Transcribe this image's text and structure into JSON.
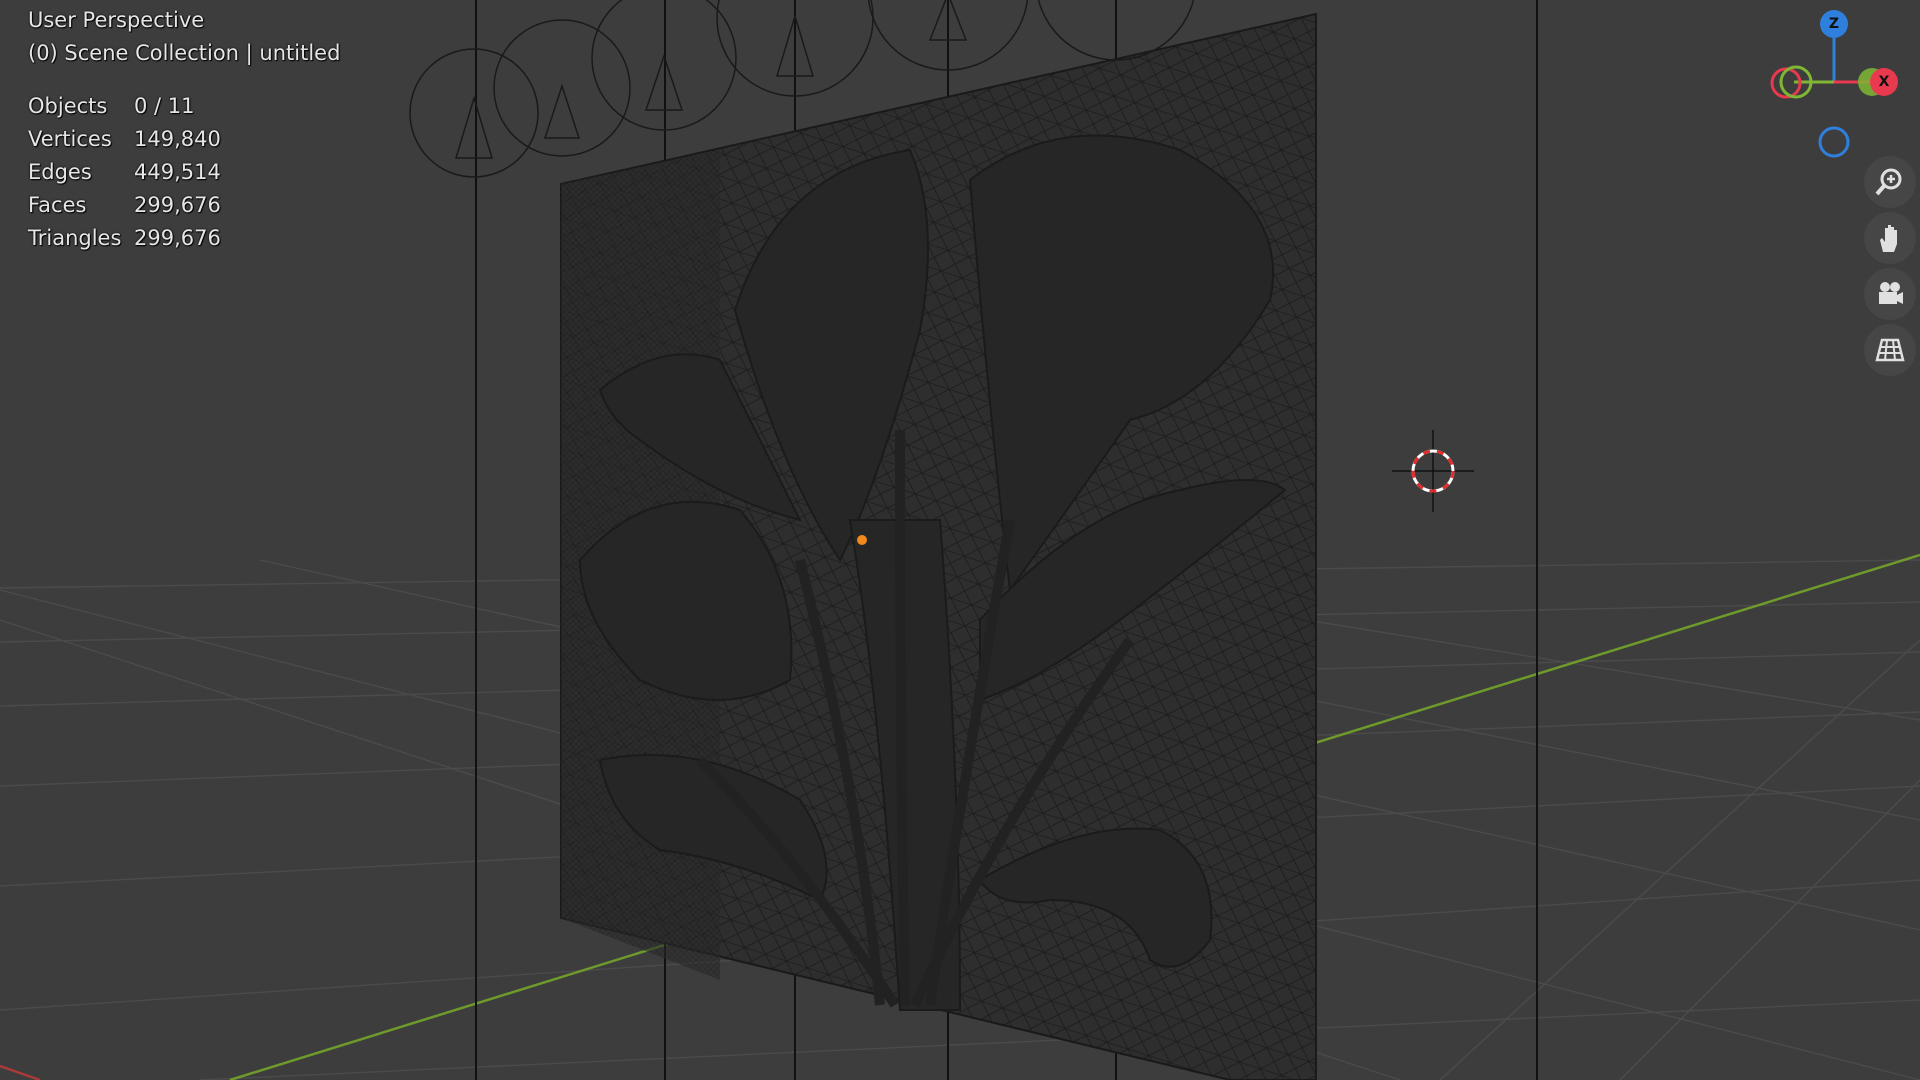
{
  "viewport": {
    "view_name": "User Perspective",
    "collection_line": "(0) Scene Collection | untitled"
  },
  "stats": [
    {
      "label": "Objects",
      "value": "0 / 11"
    },
    {
      "label": "Vertices",
      "value": "149,840"
    },
    {
      "label": "Edges",
      "value": "449,514"
    },
    {
      "label": "Faces",
      "value": "299,676"
    },
    {
      "label": "Triangles",
      "value": "299,676"
    }
  ],
  "gizmo": {
    "z_label": "Z",
    "x_label": "X",
    "colors": {
      "x": "#e8394f",
      "y": "#7fb734",
      "z": "#2f7fdc"
    }
  },
  "nav_buttons": [
    {
      "name": "zoom",
      "icon": "zoom-in-icon"
    },
    {
      "name": "pan",
      "icon": "hand-icon"
    },
    {
      "name": "camera",
      "icon": "camera-icon"
    },
    {
      "name": "ortho",
      "icon": "grid-icon"
    }
  ],
  "colors": {
    "background": "#3d3d3d",
    "grid": "#4a4a4a",
    "y_axis": "#6e9a2c",
    "panel_mesh": "#2a2a2a",
    "active_origin": "#f08a1c",
    "cursor_red": "#e52b2b"
  }
}
